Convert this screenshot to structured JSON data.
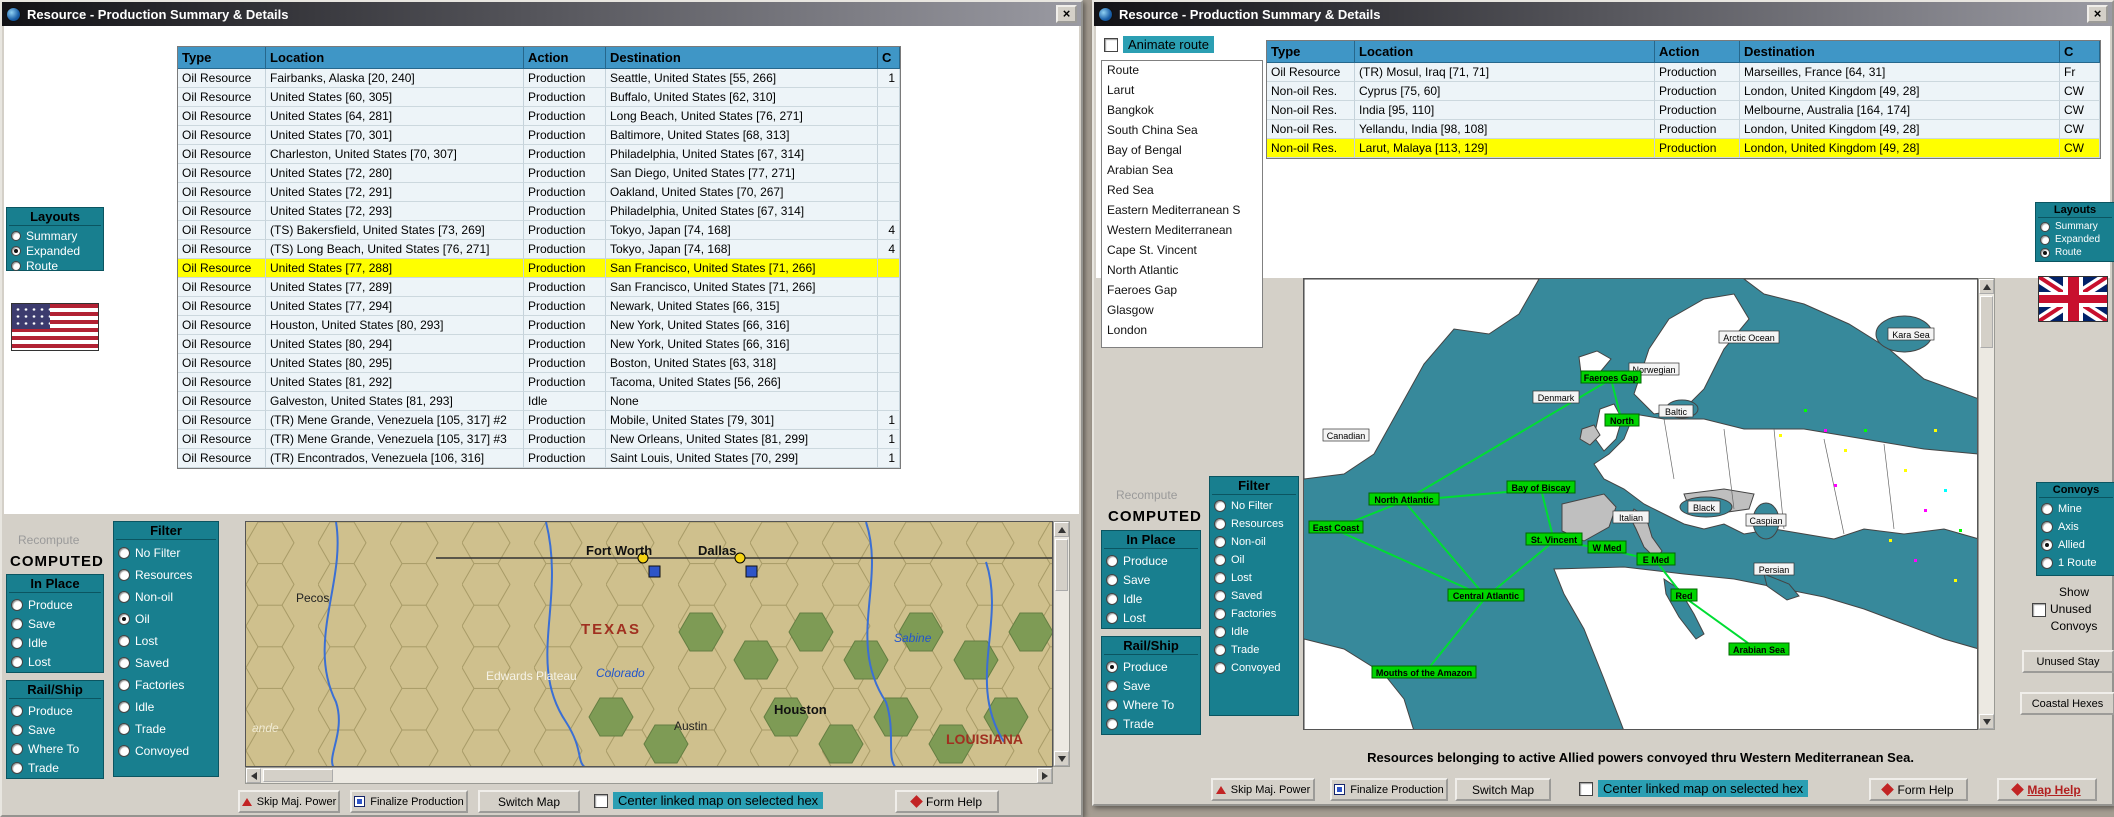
{
  "chrome": {
    "close_glyph": "×"
  },
  "left": {
    "title": "Resource - Production Summary & Details",
    "table": {
      "headers": [
        "Type",
        "Location",
        "Action",
        "Destination",
        "C"
      ],
      "rows": [
        {
          "type": "Oil Resource",
          "location": "Fairbanks, Alaska [20, 240]",
          "action": "Production",
          "destination": "Seattle, United States [55, 266]",
          "c": "1"
        },
        {
          "type": "Oil Resource",
          "location": "United States [60, 305]",
          "action": "Production",
          "destination": "Buffalo, United States [62, 310]",
          "c": ""
        },
        {
          "type": "Oil Resource",
          "location": "United States [64, 281]",
          "action": "Production",
          "destination": "Long Beach, United States [76, 271]",
          "c": ""
        },
        {
          "type": "Oil Resource",
          "location": "United States [70, 301]",
          "action": "Production",
          "destination": "Baltimore, United States [68, 313]",
          "c": ""
        },
        {
          "type": "Oil Resource",
          "location": "Charleston, United States [70, 307]",
          "action": "Production",
          "destination": "Philadelphia, United States [67, 314]",
          "c": ""
        },
        {
          "type": "Oil Resource",
          "location": "United States [72, 280]",
          "action": "Production",
          "destination": "San Diego, United States [77, 271]",
          "c": ""
        },
        {
          "type": "Oil Resource",
          "location": "United States [72, 291]",
          "action": "Production",
          "destination": "Oakland, United States [70, 267]",
          "c": ""
        },
        {
          "type": "Oil Resource",
          "location": "United States [72, 293]",
          "action": "Production",
          "destination": "Philadelphia, United States [67, 314]",
          "c": ""
        },
        {
          "type": "Oil Resource",
          "location": "(TS) Bakersfield, United States [73, 269]",
          "action": "Production",
          "destination": "Tokyo, Japan [74, 168]",
          "c": "4"
        },
        {
          "type": "Oil Resource",
          "location": "(TS) Long Beach, United States [76, 271]",
          "action": "Production",
          "destination": "Tokyo, Japan [74, 168]",
          "c": "4"
        },
        {
          "type": "Oil Resource",
          "location": "United States [77, 288]",
          "action": "Production",
          "destination": "San Francisco, United States [71, 266]",
          "c": "",
          "highlight": true
        },
        {
          "type": "Oil Resource",
          "location": "United States [77, 289]",
          "action": "Production",
          "destination": "San Francisco, United States [71, 266]",
          "c": ""
        },
        {
          "type": "Oil Resource",
          "location": "United States [77, 294]",
          "action": "Production",
          "destination": "Newark, United States [66, 315]",
          "c": ""
        },
        {
          "type": "Oil Resource",
          "location": "Houston, United States [80, 293]",
          "action": "Production",
          "destination": "New York, United States [66, 316]",
          "c": ""
        },
        {
          "type": "Oil Resource",
          "location": "United States [80, 294]",
          "action": "Production",
          "destination": "New York, United States [66, 316]",
          "c": ""
        },
        {
          "type": "Oil Resource",
          "location": "United States [80, 295]",
          "action": "Production",
          "destination": "Boston, United States [63, 318]",
          "c": ""
        },
        {
          "type": "Oil Resource",
          "location": "United States [81, 292]",
          "action": "Production",
          "destination": "Tacoma, United States [56, 266]",
          "c": ""
        },
        {
          "type": "Oil Resource",
          "location": "Galveston, United States [81, 293]",
          "action": "Idle",
          "destination": "None",
          "c": ""
        },
        {
          "type": "Oil Resource",
          "location": "(TR) Mene Grande, Venezuela [105, 317] #2",
          "action": "Production",
          "destination": "Mobile, United States [79, 301]",
          "c": "1"
        },
        {
          "type": "Oil Resource",
          "location": "(TR) Mene Grande, Venezuela [105, 317] #3",
          "action": "Production",
          "destination": "New Orleans, United States [81, 299]",
          "c": "1"
        },
        {
          "type": "Oil Resource",
          "location": "(TR) Encontrados, Venezuela [106, 316]",
          "action": "Production",
          "destination": "Saint Louis, United States [70, 299]",
          "c": "1"
        }
      ]
    },
    "layouts": {
      "title": "Layouts",
      "options": [
        {
          "label": "Summary"
        },
        {
          "label": "Expanded",
          "selected": true
        },
        {
          "label": "Route"
        }
      ]
    },
    "recompute": "Recompute",
    "computed": "COMPUTED",
    "in_place": {
      "title": "In Place",
      "options": [
        {
          "label": "Produce"
        },
        {
          "label": "Save"
        },
        {
          "label": "Idle"
        },
        {
          "label": "Lost"
        }
      ]
    },
    "rail_ship": {
      "title": "Rail/Ship",
      "options": [
        {
          "label": "Produce"
        },
        {
          "label": "Save"
        },
        {
          "label": "Where To"
        },
        {
          "label": "Trade"
        }
      ]
    },
    "filter": {
      "title": "Filter",
      "options": [
        {
          "label": "No Filter"
        },
        {
          "label": "Resources"
        },
        {
          "label": "Non-oil"
        },
        {
          "label": "Oil",
          "selected": true
        },
        {
          "label": "Lost"
        },
        {
          "label": "Saved"
        },
        {
          "label": "Factories"
        },
        {
          "label": "Idle"
        },
        {
          "label": "Trade"
        },
        {
          "label": "Convoyed"
        }
      ]
    },
    "map": {
      "labels": [
        "Pecos",
        "Fort Worth",
        "Dallas",
        "TEXAS",
        "Edwards Plateau",
        "Colorado",
        "Sabine",
        "Austin",
        "Houston",
        "LOUISIANA",
        "ande"
      ]
    },
    "buttons": {
      "skip": "Skip Maj. Power",
      "finalize": "Finalize Production",
      "switch_map": "Switch Map",
      "center_checkbox": "Center linked map on selected hex",
      "form_help": "Form Help"
    }
  },
  "right": {
    "title": "Resource - Production Summary & Details",
    "animate_checkbox": "Animate route",
    "route_list": [
      "Route",
      "Larut",
      "Bangkok",
      "South China Sea",
      "Bay of Bengal",
      "Arabian Sea",
      "Red Sea",
      "Eastern Mediterranean S",
      "Western Mediterranean",
      "Cape St. Vincent",
      "North Atlantic",
      "Faeroes Gap",
      "Glasgow",
      "London"
    ],
    "table": {
      "headers": [
        "Type",
        "Location",
        "Action",
        "Destination",
        "C"
      ],
      "rows": [
        {
          "type": "Oil Resource",
          "location": "(TR) Mosul, Iraq [71, 71]",
          "action": "Production",
          "destination": "Marseilles, France [64, 31]",
          "c": "Fr"
        },
        {
          "type": "Non-oil Res.",
          "location": "Cyprus [75, 60]",
          "action": "Production",
          "destination": "London, United Kingdom [49, 28]",
          "c": "CW"
        },
        {
          "type": "Non-oil Res.",
          "location": "India [95, 110]",
          "action": "Production",
          "destination": "Melbourne, Australia [164, 174]",
          "c": "CW"
        },
        {
          "type": "Non-oil Res.",
          "location": "Yellandu, India [98, 108]",
          "action": "Production",
          "destination": "London, United Kingdom [49, 28]",
          "c": "CW"
        },
        {
          "type": "Non-oil Res.",
          "location": "Larut, Malaya [113, 129]",
          "action": "Production",
          "destination": "London, United Kingdom [49, 28]",
          "c": "CW",
          "highlight": true
        }
      ]
    },
    "layouts": {
      "title": "Layouts",
      "options": [
        {
          "label": "Summary"
        },
        {
          "label": "Expanded"
        },
        {
          "label": "Route",
          "selected": true
        }
      ]
    },
    "recompute": "Recompute",
    "computed": "COMPUTED",
    "in_place": {
      "title": "In Place",
      "options": [
        {
          "label": "Produce"
        },
        {
          "label": "Save"
        },
        {
          "label": "Idle"
        },
        {
          "label": "Lost"
        }
      ]
    },
    "filter": {
      "title": "Filter",
      "options": [
        {
          "label": "No Filter"
        },
        {
          "label": "Resources"
        },
        {
          "label": "Non-oil"
        },
        {
          "label": "Oil"
        },
        {
          "label": "Lost"
        },
        {
          "label": "Saved"
        },
        {
          "label": "Factories"
        },
        {
          "label": "Idle"
        },
        {
          "label": "Trade"
        },
        {
          "label": "Convoyed"
        }
      ]
    },
    "rail_ship": {
      "title": "Rail/Ship",
      "options": [
        {
          "label": "Produce",
          "selected": true
        },
        {
          "label": "Save"
        },
        {
          "label": "Where To"
        },
        {
          "label": "Trade"
        }
      ]
    },
    "convoys": {
      "title": "Convoys",
      "options": [
        {
          "label": "Mine"
        },
        {
          "label": "Axis"
        },
        {
          "label": "Allied",
          "selected": true
        },
        {
          "label": "1 Route"
        }
      ]
    },
    "show_unused": {
      "line1": "Show",
      "line2": "Unused",
      "line3": "Convoys"
    },
    "side_buttons": {
      "unused_stay": "Unused Stay",
      "coastal_hexes": "Coastal Hexes"
    },
    "status": "Resources belonging to active Allied powers convoyed thru Western Mediterranean Sea.",
    "map": {
      "sea_labels": [
        "Arctic Ocean",
        "Kara Sea",
        "Norwegian",
        "Canadian",
        "Denmark",
        "Baltic",
        "Italian",
        "Black",
        "Caspian",
        "Persian"
      ],
      "node_labels": [
        "Faeroes Gap",
        "North",
        "North Atlantic",
        "Bay of Biscay",
        "East Coast",
        "St. Vincent",
        "W Med",
        "E Med",
        "Central Atlantic",
        "Mouths of the Amazon",
        "Red",
        "Arabian Sea"
      ]
    },
    "buttons": {
      "skip": "Skip Maj. Power",
      "finalize": "Finalize Production",
      "switch_map": "Switch Map",
      "center_checkbox": "Center linked map on selected hex",
      "form_help": "Form Help",
      "map_help": "Map Help"
    }
  }
}
